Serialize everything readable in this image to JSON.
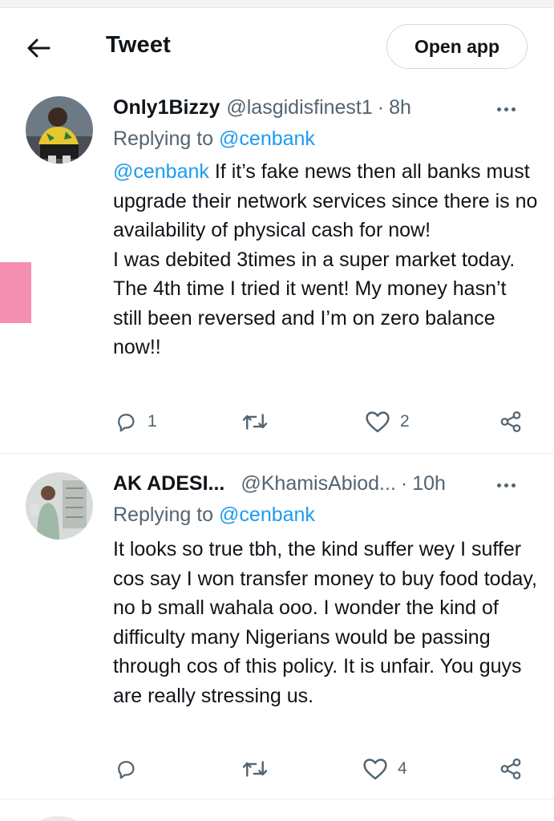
{
  "header": {
    "title": "Tweet",
    "open_app_label": "Open app"
  },
  "tweets": [
    {
      "name": "Only1Bizzy",
      "handle": "@lasgidisfinest1",
      "separator": "·",
      "time": "8h",
      "replying_prefix": "Replying to",
      "replying_to": "@cenbank",
      "body_mention": "@cenbank",
      "body_text": " If it’s fake news then all banks must upgrade their network services since there is no availability of physical cash for now!\nI was debited 3times in a super market today. The 4th time I tried it went! My money hasn’t still been reversed and I’m on zero balance now!!",
      "reply_count": "1",
      "retweet_count": "",
      "like_count": "2"
    },
    {
      "name": "AK ADESI...",
      "handle": "@KhamisAbiod...",
      "separator": "·",
      "time": "10h",
      "replying_prefix": "Replying to",
      "replying_to": "@cenbank",
      "body_mention": "",
      "body_text": "It looks so true tbh, the kind suffer wey I suffer cos say I won transfer money to buy food today, no b small wahala ooo. I wonder the kind of difficulty many Nigerians would be passing through cos of this policy. It is unfair. You guys are really stressing us.",
      "reply_count": "",
      "retweet_count": "",
      "like_count": "4"
    }
  ],
  "icons": {
    "back": "arrow-left-icon",
    "more": "more-horizontal-icon",
    "reply": "reply-bubble-icon",
    "retweet": "retweet-icon",
    "like": "heart-icon",
    "share": "share-icon"
  },
  "colors": {
    "text": "#0f1419",
    "muted": "#536471",
    "link": "#1d9bf0",
    "accent_tab": "#f48fb1",
    "divider": "#e6ecf0"
  }
}
